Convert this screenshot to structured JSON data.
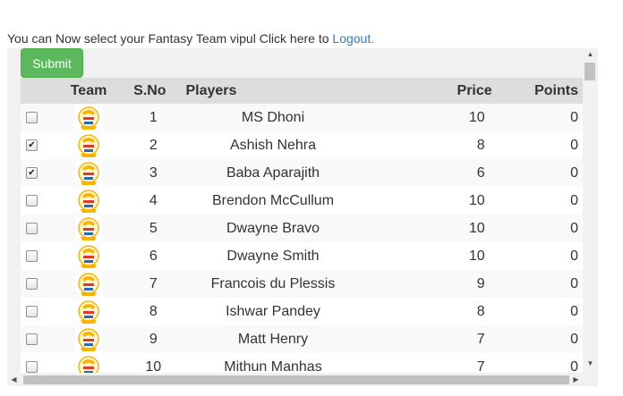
{
  "intro": {
    "text": "You can Now select your Fantasy Team vipul Click here to ",
    "link": "Logout."
  },
  "submit_label": "Submit",
  "table": {
    "headers": [
      "Team",
      "S.No",
      "Players",
      "Price",
      "Points"
    ],
    "rows": [
      {
        "checked": false,
        "sno": "1",
        "player": "MS Dhoni",
        "price": "10",
        "points": "0"
      },
      {
        "checked": true,
        "sno": "2",
        "player": "Ashish Nehra",
        "price": "8",
        "points": "0"
      },
      {
        "checked": true,
        "sno": "3",
        "player": "Baba Aparajith",
        "price": "6",
        "points": "0"
      },
      {
        "checked": false,
        "sno": "4",
        "player": "Brendon McCullum",
        "price": "10",
        "points": "0"
      },
      {
        "checked": false,
        "sno": "5",
        "player": "Dwayne Bravo",
        "price": "10",
        "points": "0"
      },
      {
        "checked": false,
        "sno": "6",
        "player": "Dwayne Smith",
        "price": "10",
        "points": "0"
      },
      {
        "checked": false,
        "sno": "7",
        "player": "Francois du Plessis",
        "price": "9",
        "points": "0"
      },
      {
        "checked": false,
        "sno": "8",
        "player": "Ishwar Pandey",
        "price": "8",
        "points": "0"
      },
      {
        "checked": false,
        "sno": "9",
        "player": "Matt Henry",
        "price": "7",
        "points": "0"
      },
      {
        "checked": false,
        "sno": "10",
        "player": "Mithun Manhas",
        "price": "7",
        "points": "0"
      }
    ]
  },
  "team_logo_icon": "super-kings-logo-icon",
  "colors": {
    "submit_bg": "#5cb85c",
    "link": "#337ab7",
    "header_bg": "#dddddd",
    "logo_yellow": "#f7b500",
    "logo_red": "#e03a2e"
  }
}
